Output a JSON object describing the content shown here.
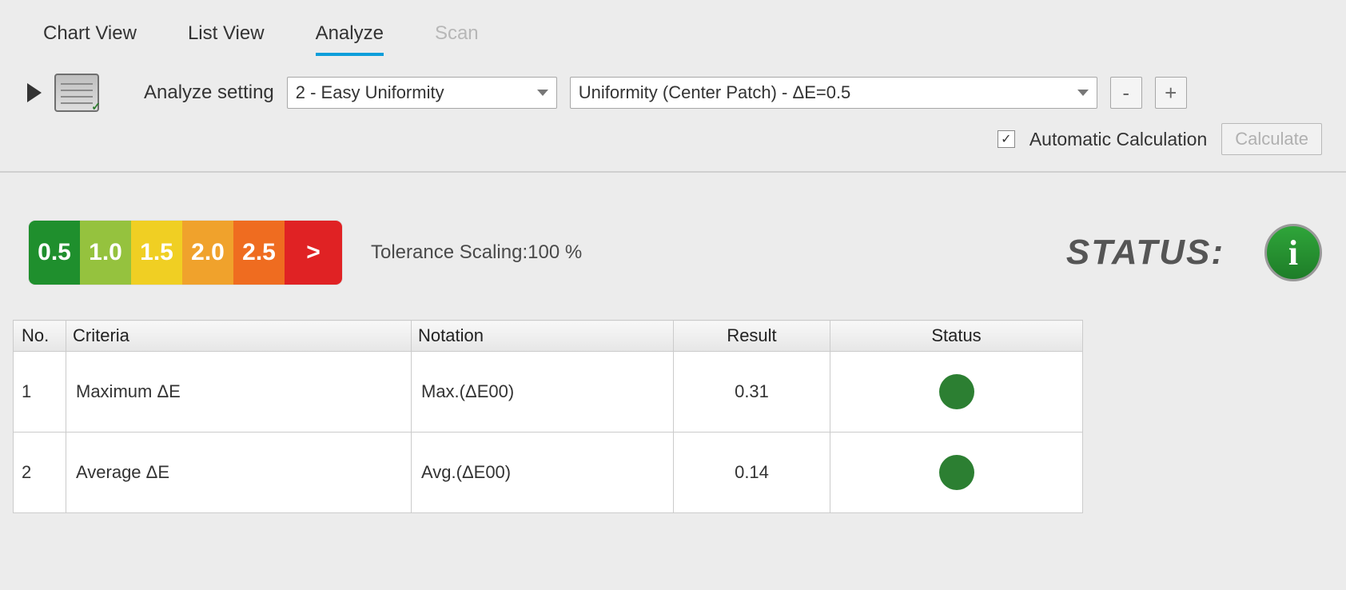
{
  "tabs": {
    "chart_view": "Chart View",
    "list_view": "List View",
    "analyze": "Analyze",
    "scan": "Scan",
    "active": "analyze"
  },
  "toolbar": {
    "analyze_setting_label": "Analyze setting",
    "select_setting": "2 - Easy Uniformity",
    "select_metric": "Uniformity (Center Patch) - ΔE=0.5",
    "minus_label": "-",
    "plus_label": "+"
  },
  "calc": {
    "auto_checked": true,
    "auto_label": "Automatic Calculation",
    "calculate_label": "Calculate"
  },
  "scale": {
    "cells": [
      "0.5",
      "1.0",
      "1.5",
      "2.0",
      "2.5",
      ">"
    ],
    "tolerance_prefix": "Tolerance Scaling:",
    "tolerance_value": "100 %"
  },
  "status": {
    "label": "STATUS:",
    "badge_glyph": "i"
  },
  "table": {
    "headers": {
      "no": "No.",
      "criteria": "Criteria",
      "notation": "Notation",
      "result": "Result",
      "status": "Status"
    },
    "rows": [
      {
        "no": "1",
        "criteria": "Maximum ΔE",
        "notation": "Max.(ΔE00)",
        "result": "0.31",
        "status_color": "#2c7f32"
      },
      {
        "no": "2",
        "criteria": "Average ΔE",
        "notation": "Avg.(ΔE00)",
        "result": "0.14",
        "status_color": "#2c7f32"
      }
    ]
  }
}
